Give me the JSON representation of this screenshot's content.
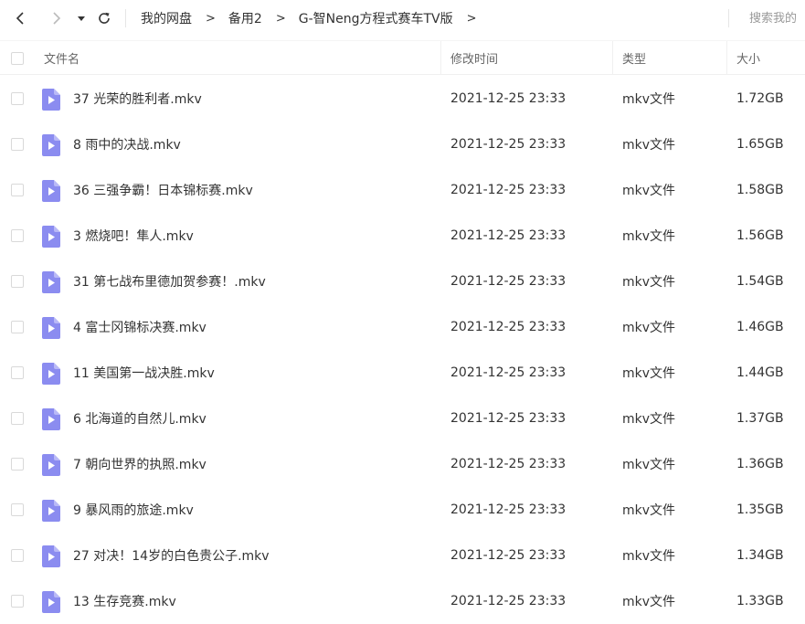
{
  "toolbar": {
    "back_icon": "chevron-left-icon",
    "forward_icon": "chevron-right-icon",
    "dropdown_icon": "caret-down-icon",
    "refresh_icon": "refresh-icon",
    "breadcrumb": [
      "我的网盘",
      "备用2",
      "G-智Neng方程式赛车TV版"
    ],
    "crumb_separator": ">",
    "search_placeholder": "搜索我的"
  },
  "table": {
    "headers": {
      "name": "文件名",
      "modified": "修改时间",
      "type": "类型",
      "size": "大小"
    },
    "rows": [
      {
        "name": "37 光荣的胜利者.mkv",
        "modified": "2021-12-25 23:33",
        "type": "mkv文件",
        "size": "1.72GB"
      },
      {
        "name": "8 雨中的决战.mkv",
        "modified": "2021-12-25 23:33",
        "type": "mkv文件",
        "size": "1.65GB"
      },
      {
        "name": "36 三强争霸！日本锦标赛.mkv",
        "modified": "2021-12-25 23:33",
        "type": "mkv文件",
        "size": "1.58GB"
      },
      {
        "name": "3 燃烧吧！隼人.mkv",
        "modified": "2021-12-25 23:33",
        "type": "mkv文件",
        "size": "1.56GB"
      },
      {
        "name": "31 第七战布里德加贺参赛！.mkv",
        "modified": "2021-12-25 23:33",
        "type": "mkv文件",
        "size": "1.54GB"
      },
      {
        "name": "4 富士冈锦标决赛.mkv",
        "modified": "2021-12-25 23:33",
        "type": "mkv文件",
        "size": "1.46GB"
      },
      {
        "name": "11 美国第一战决胜.mkv",
        "modified": "2021-12-25 23:33",
        "type": "mkv文件",
        "size": "1.44GB"
      },
      {
        "name": "6 北海道的自然儿.mkv",
        "modified": "2021-12-25 23:33",
        "type": "mkv文件",
        "size": "1.37GB"
      },
      {
        "name": "7 朝向世界的执照.mkv",
        "modified": "2021-12-25 23:33",
        "type": "mkv文件",
        "size": "1.36GB"
      },
      {
        "name": "9 暴风雨的旅途.mkv",
        "modified": "2021-12-25 23:33",
        "type": "mkv文件",
        "size": "1.35GB"
      },
      {
        "name": "27 对决！14岁的白色贵公子.mkv",
        "modified": "2021-12-25 23:33",
        "type": "mkv文件",
        "size": "1.34GB"
      },
      {
        "name": "13 生存竞赛.mkv",
        "modified": "2021-12-25 23:33",
        "type": "mkv文件",
        "size": "1.33GB"
      }
    ]
  },
  "colors": {
    "video_icon": "#8b8cf0",
    "video_icon_fold": "#b9b9f7"
  }
}
